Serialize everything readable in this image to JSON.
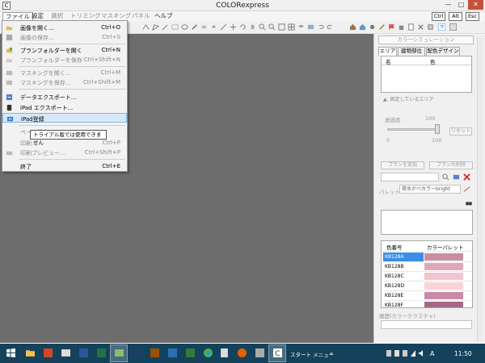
{
  "window": {
    "title": "COLORexpress",
    "icon_letter": "C"
  },
  "menubar": {
    "items": [
      {
        "label": "ファイル",
        "active": true
      },
      {
        "label": "設定"
      },
      {
        "label": "選択",
        "dim": true
      },
      {
        "label": "トリミング",
        "dim": true
      },
      {
        "label": "マスキング",
        "dim": true
      },
      {
        "label": "パネル",
        "dim": true
      },
      {
        "label": "ヘルプ"
      }
    ],
    "keys": [
      "Ctrl",
      "Alt",
      "Esc"
    ]
  },
  "file_menu": {
    "items": [
      {
        "label": "画像を開く...",
        "shortcut": "Ctrl+O",
        "icon": "folder-open-icon",
        "disabled": false
      },
      {
        "label": "画像の保存...",
        "shortcut": "Ctrl+S",
        "icon": "save-icon",
        "disabled": true
      },
      {
        "label": "プランフォルダーを開く",
        "shortcut": "Ctrl+N",
        "icon": "plan-folder-icon",
        "disabled": false
      },
      {
        "label": "プランフォルダーを保存",
        "shortcut": "Ctrl+Shift+N",
        "icon": "plan-save-icon",
        "disabled": true
      },
      {
        "label": "マスキングを開く...",
        "shortcut": "Ctrl+M",
        "icon": "mask-open-icon",
        "disabled": true
      },
      {
        "label": "マスキングを保存...",
        "shortcut": "Ctrl+Shift+M",
        "icon": "mask-save-icon",
        "disabled": true
      },
      {
        "label": "データエクスポート...",
        "shortcut": "",
        "icon": "data-export-icon",
        "disabled": false
      },
      {
        "label": "iPad エクスポート...",
        "shortcut": "",
        "icon": "ipad-export-icon",
        "disabled": false
      },
      {
        "label": "iPad登録",
        "shortcut": "",
        "icon": "ipad-register-icon",
        "disabled": false,
        "highlighted": true
      },
      {
        "label": "ページ設定...",
        "shortcut": "",
        "icon": "",
        "disabled": true
      },
      {
        "label": "印刷...",
        "shortcut": "Ctrl+P",
        "icon": "",
        "disabled": true
      },
      {
        "label": "印刷プレビュー...",
        "shortcut": "Ctrl+Shift+P",
        "icon": "print-preview-icon",
        "disabled": true
      },
      {
        "label": "終了",
        "shortcut": "Ctrl+E",
        "icon": "",
        "disabled": false
      }
    ],
    "tooltip": "トライアル版では使用できません"
  },
  "panel": {
    "header": "カラーシミュレーション",
    "tabs": [
      "エリア",
      "建物部位",
      "配色デザイン"
    ],
    "area_columns": [
      "名",
      "色"
    ],
    "area_note": "▲: 固定しているエリア",
    "transparency_label": "透過度",
    "transparency_value": "100",
    "slider_min": "0",
    "slider_max": "100",
    "reset_label": "リセット",
    "add_plan_label": "プランを追加",
    "delete_plan_label": "プランの削除",
    "palette_label": "パレット",
    "palette_select": "荷水かべカラーbright",
    "palette_columns": [
      "色番号",
      "カラーパレット"
    ],
    "palette_rows": [
      {
        "code": "KB128A",
        "color": "#c98ea4",
        "selected": true
      },
      {
        "code": "KB128B",
        "color": "#e0a8b9"
      },
      {
        "code": "KB128C",
        "color": "#f2c4cf"
      },
      {
        "code": "KB128D",
        "color": "#f9d3d6"
      },
      {
        "code": "KB128E",
        "color": "#c98aa7"
      },
      {
        "code": "KB128F",
        "color": "#a46787"
      }
    ],
    "history_label": "履歴(カラーテクスチャ)"
  },
  "taskbar": {
    "start_menu_label": "スタート メニュー",
    "chevron": "»",
    "ime": "A",
    "clock": "11:50"
  }
}
